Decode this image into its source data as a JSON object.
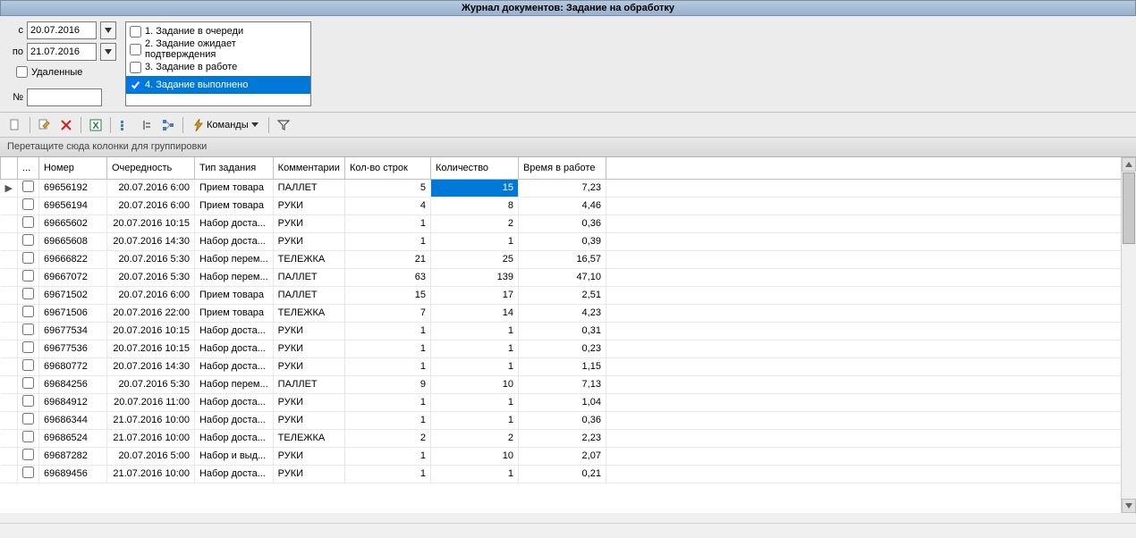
{
  "title": "Журнал документов: Задание на обработку",
  "filter": {
    "from_label": "с",
    "to_label": "по",
    "from_date": "20.07.2016",
    "to_date": "21.07.2016",
    "deleted_label": "Удаленные",
    "deleted_checked": false,
    "num_label": "№",
    "num_value": ""
  },
  "status_filters": [
    {
      "label": "1. Задание в очереди",
      "checked": false
    },
    {
      "label": "2. Задание ожидает подтверждения",
      "checked": false
    },
    {
      "label": "3. Задание в работе",
      "checked": false
    },
    {
      "label": "4. Задание выполнено",
      "checked": true
    }
  ],
  "toolbar": {
    "commands_label": "Команды"
  },
  "group_bar": "Перетащите сюда колонки для группировки",
  "columns": {
    "indicator": "",
    "ellipsis": "...",
    "number": "Номер",
    "queue": "Очередность",
    "task_type": "Тип задания",
    "comments": "Комментарии",
    "line_count": "Кол-во строк",
    "quantity": "Количество",
    "work_time": "Время в работе"
  },
  "rows": [
    {
      "ind": "▶",
      "num": "69656192",
      "queue": "20.07.2016 6:00",
      "type": "Прием товара",
      "com": "ПАЛЛЕТ",
      "lines": "5",
      "qty": "15",
      "time": "7,23",
      "qty_sel": true
    },
    {
      "ind": "",
      "num": "69656194",
      "queue": "20.07.2016 6:00",
      "type": "Прием товара",
      "com": "РУКИ",
      "lines": "4",
      "qty": "8",
      "time": "4,46"
    },
    {
      "ind": "",
      "num": "69665602",
      "queue": "20.07.2016 10:15",
      "type": "Набор доста...",
      "com": "РУКИ",
      "lines": "1",
      "qty": "2",
      "time": "0,36"
    },
    {
      "ind": "",
      "num": "69665608",
      "queue": "20.07.2016 14:30",
      "type": "Набор доста...",
      "com": "РУКИ",
      "lines": "1",
      "qty": "1",
      "time": "0,39"
    },
    {
      "ind": "",
      "num": "69666822",
      "queue": "20.07.2016 5:30",
      "type": "Набор перем...",
      "com": "ТЕЛЕЖКА",
      "lines": "21",
      "qty": "25",
      "time": "16,57"
    },
    {
      "ind": "",
      "num": "69667072",
      "queue": "20.07.2016 5:30",
      "type": "Набор перем...",
      "com": "ПАЛЛЕТ",
      "lines": "63",
      "qty": "139",
      "time": "47,10"
    },
    {
      "ind": "",
      "num": "69671502",
      "queue": "20.07.2016 6:00",
      "type": "Прием товара",
      "com": "ПАЛЛЕТ",
      "lines": "15",
      "qty": "17",
      "time": "2,51"
    },
    {
      "ind": "",
      "num": "69671506",
      "queue": "20.07.2016 22:00",
      "type": "Прием товара",
      "com": "ТЕЛЕЖКА",
      "lines": "7",
      "qty": "14",
      "time": "4,23"
    },
    {
      "ind": "",
      "num": "69677534",
      "queue": "20.07.2016 10:15",
      "type": "Набор доста...",
      "com": "РУКИ",
      "lines": "1",
      "qty": "1",
      "time": "0,31"
    },
    {
      "ind": "",
      "num": "69677536",
      "queue": "20.07.2016 10:15",
      "type": "Набор доста...",
      "com": "РУКИ",
      "lines": "1",
      "qty": "1",
      "time": "0,23"
    },
    {
      "ind": "",
      "num": "69680772",
      "queue": "20.07.2016 14:30",
      "type": "Набор доста...",
      "com": "РУКИ",
      "lines": "1",
      "qty": "1",
      "time": "1,15"
    },
    {
      "ind": "",
      "num": "69684256",
      "queue": "20.07.2016 5:30",
      "type": "Набор перем...",
      "com": "ПАЛЛЕТ",
      "lines": "9",
      "qty": "10",
      "time": "7,13"
    },
    {
      "ind": "",
      "num": "69684912",
      "queue": "20.07.2016 11:00",
      "type": "Набор доста...",
      "com": "РУКИ",
      "lines": "1",
      "qty": "1",
      "time": "1,04"
    },
    {
      "ind": "",
      "num": "69686344",
      "queue": "21.07.2016 10:00",
      "type": "Набор доста...",
      "com": "РУКИ",
      "lines": "1",
      "qty": "1",
      "time": "0,36"
    },
    {
      "ind": "",
      "num": "69686524",
      "queue": "21.07.2016 10:00",
      "type": "Набор доста...",
      "com": "ТЕЛЕЖКА",
      "lines": "2",
      "qty": "2",
      "time": "2,23"
    },
    {
      "ind": "",
      "num": "69687282",
      "queue": "20.07.2016 5:00",
      "type": "Набор и выд...",
      "com": "РУКИ",
      "lines": "1",
      "qty": "10",
      "time": "2,07"
    },
    {
      "ind": "",
      "num": "69689456",
      "queue": "21.07.2016 10:00",
      "type": "Набор доста...",
      "com": "РУКИ",
      "lines": "1",
      "qty": "1",
      "time": "0,21"
    }
  ]
}
